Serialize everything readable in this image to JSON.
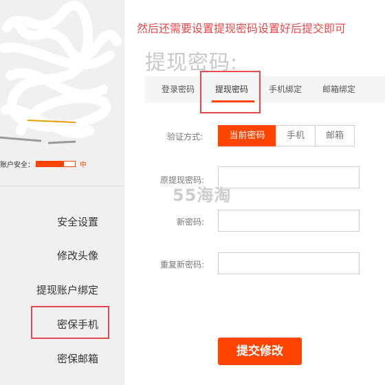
{
  "sidebar": {
    "security_label": "账户安全：",
    "security_level_text": "中",
    "security_strength": 0.72,
    "items": [
      {
        "label": "安全设置"
      },
      {
        "label": "修改头像"
      },
      {
        "label": "提现账户绑定"
      },
      {
        "label": "密保手机"
      },
      {
        "label": "密保邮箱"
      }
    ]
  },
  "annotation": {
    "caption": "然后还需要设置提现密码设置好后提交即可"
  },
  "main": {
    "title": "提现密码:",
    "tabs": [
      {
        "label": "登录密码"
      },
      {
        "label": "提现密码"
      },
      {
        "label": "手机绑定"
      },
      {
        "label": "邮箱绑定"
      }
    ],
    "verify_label": "验证方式:",
    "methods": [
      {
        "label": "当前密码"
      },
      {
        "label": "手机"
      },
      {
        "label": "邮箱"
      }
    ],
    "fields": {
      "original_label": "原提现密码:",
      "new_label": "新密码:",
      "repeat_label": "重复新密码:"
    },
    "submit_label": "提交修改"
  },
  "watermark": "55海淘",
  "colors": {
    "accent": "#ff4400",
    "highlight": "#e5484d"
  }
}
